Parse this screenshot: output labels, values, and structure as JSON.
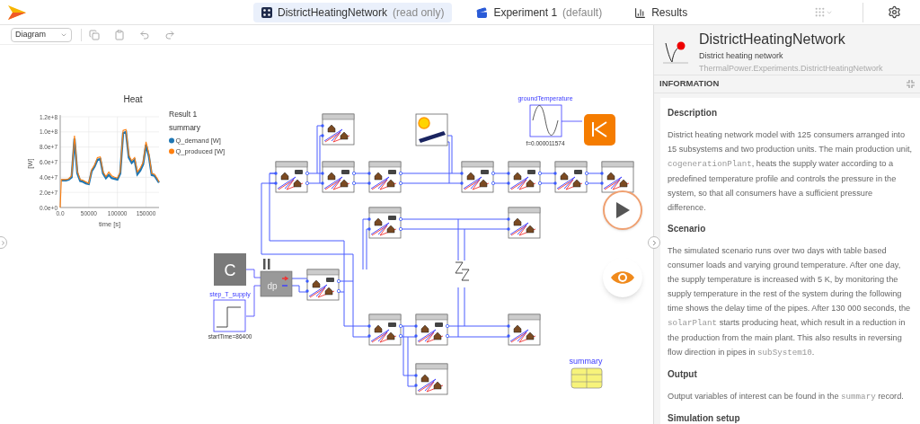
{
  "app_bar": {
    "tabs": [
      {
        "label": "DistrictHeatingNetwork",
        "note": "(read only)",
        "kind": "model",
        "selected": true
      },
      {
        "label": "Experiment 1",
        "note": "(default)",
        "kind": "experiment",
        "selected": false
      },
      {
        "label": "Results",
        "kind": "results",
        "selected": false
      }
    ]
  },
  "toolbar": {
    "view_select": "Diagram"
  },
  "plot": {
    "legend_title": "Result 1",
    "legend_group": "summary",
    "chart_data": {
      "type": "line",
      "title": "Heat",
      "xlabel": "time [s]",
      "ylabel": "[W]",
      "x": [
        0,
        2000,
        10000,
        15000,
        20000,
        25000,
        30000,
        35000,
        40000,
        45000,
        50000,
        55000,
        60000,
        65000,
        70000,
        75000,
        80000,
        85000,
        90000,
        95000,
        100000,
        105000,
        110000,
        115000,
        120000,
        125000,
        130000,
        135000,
        140000,
        145000,
        150000,
        155000,
        160000,
        165000,
        170000,
        172800
      ],
      "series": [
        {
          "name": "Q_demand [W]",
          "color": "#1f77b4",
          "values": [
            null,
            36000000,
            36000000,
            37000000,
            40000000,
            91000000,
            45000000,
            35000000,
            34000000,
            32000000,
            31000000,
            48000000,
            54000000,
            63000000,
            64000000,
            45000000,
            39000000,
            43000000,
            39000000,
            38000000,
            37000000,
            45000000,
            98000000,
            100000000,
            66000000,
            59000000,
            63000000,
            44000000,
            49000000,
            57000000,
            83000000,
            68000000,
            43000000,
            42000000,
            36000000,
            33000000
          ]
        },
        {
          "name": "Q_produced [W]",
          "color": "#ff7f0e",
          "values": [
            0,
            37000000,
            37000000,
            38000000,
            42000000,
            95000000,
            48000000,
            37000000,
            36000000,
            34000000,
            32000000,
            50000000,
            56000000,
            66000000,
            67000000,
            47000000,
            41000000,
            47000000,
            42000000,
            40000000,
            39000000,
            47000000,
            102000000,
            103000000,
            69000000,
            62000000,
            66000000,
            47000000,
            52000000,
            60000000,
            87000000,
            71000000,
            45000000,
            44000000,
            38000000,
            34000000
          ]
        }
      ],
      "grid": true,
      "legend": "right",
      "xlim": [
        0,
        172800
      ],
      "ylim": [
        0,
        120000000
      ],
      "xticks": [
        {
          "value": 0,
          "label": "0.0"
        },
        {
          "value": 50000,
          "label": "50000"
        },
        {
          "value": 100000,
          "label": "100000"
        },
        {
          "value": 150000,
          "label": "150000"
        }
      ],
      "yticks": [
        {
          "value": 0,
          "label": "0.0e+0"
        },
        {
          "value": 20000000,
          "label": "2.0e+7"
        },
        {
          "value": 40000000,
          "label": "4.0e+7"
        },
        {
          "value": 60000000,
          "label": "6.0e+7"
        },
        {
          "value": 80000000,
          "label": "8.0e+7"
        },
        {
          "value": 100000000,
          "label": "1.0e+8"
        },
        {
          "value": 120000000,
          "label": "1.2e+8"
        }
      ]
    }
  },
  "diagram": {
    "ground_temperature_label": "groundTemperature",
    "frequency_label": "f=0.000011574",
    "constant_symbol": "C",
    "plant_symbol": "dp",
    "step_label": "step_T_supply",
    "step_parameter": "startTime=86400",
    "summary_label": "summary"
  },
  "panel": {
    "title": "DistrictHeatingNetwork",
    "subtitle": "District heating network",
    "path": "ThermalPower.Experiments.DistrictHeatingNetwork",
    "section_header": "INFORMATION",
    "sections": [
      {
        "heading": "Description",
        "paragraphs": [
          [
            {
              "kind": "text",
              "text": "District heating network model with 125 consumers arranged into 15 subsystems and two production units. The main production unit, "
            },
            {
              "kind": "code",
              "text": "cogenerationPlant"
            },
            {
              "kind": "text",
              "text": ", heats the supply water according to a predefined temperature profile and controls the pressure in the system, so that all consumers have a sufficient pressure difference."
            }
          ]
        ]
      },
      {
        "heading": "Scenario",
        "paragraphs": [
          [
            {
              "kind": "text",
              "text": "The simulated scenario runs over two days with table based consumer loads and varying ground temperature. After one day, the supply temperature is increased with 5 K, by monitoring the supply temperature in the rest of the system during the following time shows the delay time of the pipes. After 130 000 seconds, the "
            },
            {
              "kind": "code",
              "text": "solarPlant"
            },
            {
              "kind": "text",
              "text": " starts producing heat, which result in a reduction in the production from the main plant. This also results in reversing flow direction in pipes in "
            },
            {
              "kind": "code",
              "text": "subSystem10"
            },
            {
              "kind": "text",
              "text": "."
            }
          ]
        ]
      },
      {
        "heading": "Output",
        "paragraphs": [
          [
            {
              "kind": "text",
              "text": "Output variables of interest can be found in the "
            },
            {
              "kind": "code",
              "text": "summary"
            },
            {
              "kind": "text",
              "text": " record."
            }
          ]
        ]
      },
      {
        "heading": "Simulation setup"
      }
    ]
  }
}
